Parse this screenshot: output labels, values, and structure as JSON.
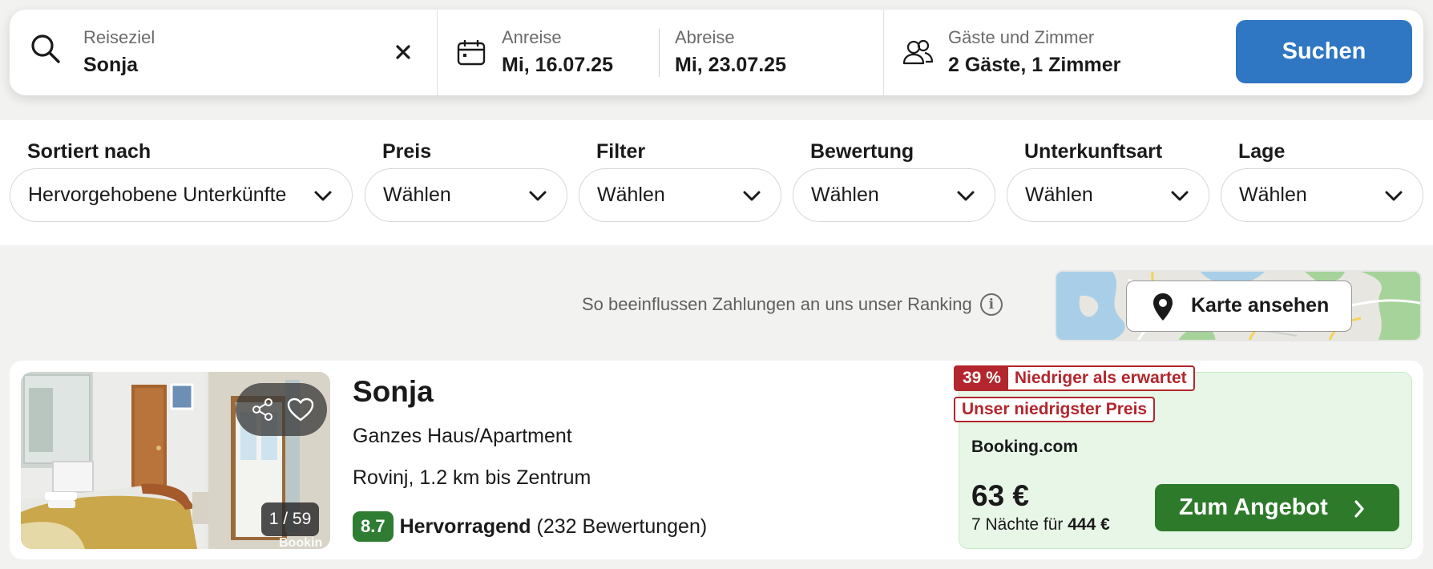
{
  "search": {
    "destination_label": "Reiseziel",
    "destination_value": "Sonja",
    "checkin_label": "Anreise",
    "checkin_value": "Mi, 16.07.25",
    "checkout_label": "Abreise",
    "checkout_value": "Mi, 23.07.25",
    "guests_label": "Gäste und Zimmer",
    "guests_value": "2 Gäste, 1 Zimmer",
    "search_button": "Suchen"
  },
  "filters": [
    {
      "title": "Sortiert nach",
      "value": "Hervorgehobene Unterkünfte"
    },
    {
      "title": "Preis",
      "value": "Wählen"
    },
    {
      "title": "Filter",
      "value": "Wählen"
    },
    {
      "title": "Bewertung",
      "value": "Wählen"
    },
    {
      "title": "Unterkunftsart",
      "value": "Wählen"
    },
    {
      "title": "Lage",
      "value": "Wählen"
    }
  ],
  "ranking_text": "So beeinflussen Zahlungen an uns unser Ranking",
  "ranking_info_glyph": "i",
  "map_button": "Karte ansehen",
  "result": {
    "photo_counter": "1 / 59",
    "photo_watermark": "Bookin",
    "name": "Sonja",
    "type": "Ganzes Haus/Apartment",
    "location": "Rovinj, 1.2 km bis Zentrum",
    "score": "8.7",
    "rating_label": "Hervorragend",
    "reviews": "(232 Bewertungen)",
    "discount_pct": "39 %",
    "discount_text": "Niedriger als erwartet",
    "lowest_badge": "Unser niedrigster Preis",
    "provider": "Booking.com",
    "price": "63 €",
    "nights_text": "7 Nächte für",
    "total": "444 €",
    "offer_button": "Zum Angebot"
  },
  "colors": {
    "primary_blue": "#2f76c3",
    "score_green": "#2e7d32",
    "offer_green": "#2d7a2b",
    "deal_red": "#b3262d",
    "deal_bg": "#e7f6e6"
  }
}
